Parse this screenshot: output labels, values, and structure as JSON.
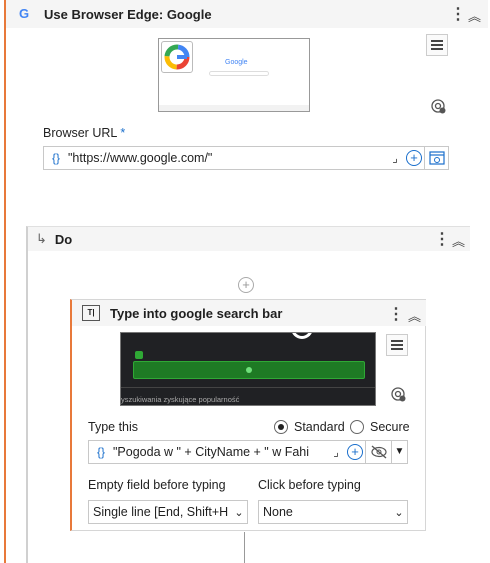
{
  "activity": {
    "title": "Use Browser Edge: Google",
    "app_icon": "G",
    "browser_url_label": "Browser URL",
    "required_mark": "*",
    "url_value": "\"https://www.google.com/\"",
    "brace": "{}",
    "thumb_text": "Google"
  },
  "do": {
    "title": "Do",
    "arrow": "↳"
  },
  "type_into": {
    "title": "Type into google search bar",
    "icon_text": "T|",
    "thumb_caption": "yszukiwania zyskujące popularność",
    "type_this_label": "Type this",
    "radio_standard": "Standard",
    "radio_secure": "Secure",
    "value": "\"Pogoda w \" + CityName + \" w Fahi",
    "empty_field_label": "Empty field before typing",
    "empty_field_value": "Single line [End, Shift+H",
    "click_before_label": "Click before typing",
    "click_before_value": "None"
  },
  "colors": {
    "accent": "#e8793a",
    "link": "#1a6fcc",
    "highlight": "#2fa835"
  }
}
